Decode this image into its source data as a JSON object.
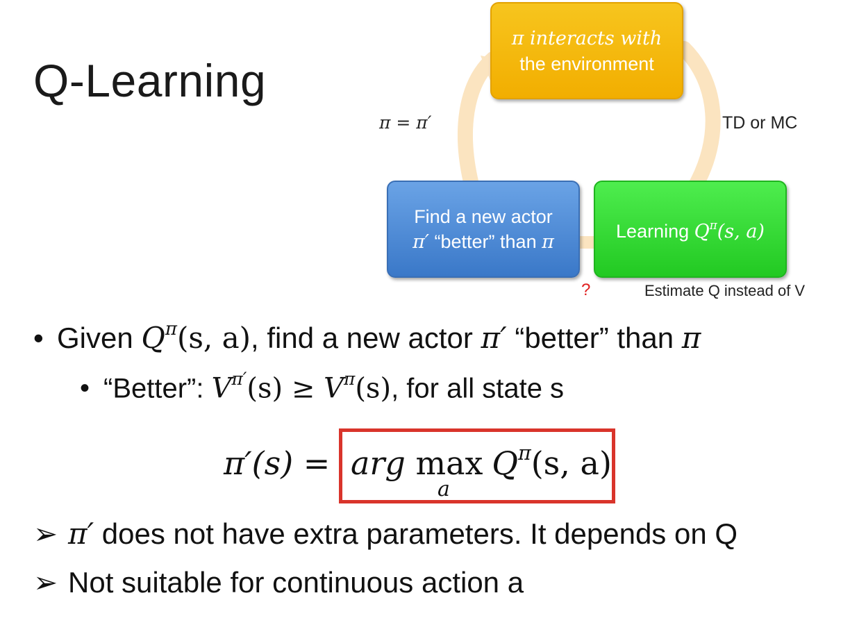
{
  "slide": {
    "title": "Q-Learning"
  },
  "diagram": {
    "box_interacts_line1": "π interacts with",
    "box_interacts_line2": "the environment",
    "box_actor_line1": "Find a new actor",
    "box_actor_line2_pi": "π′",
    "box_actor_line2_text": " “better” than ",
    "box_actor_line2_pi2": "π",
    "box_learning_text": "Learning ",
    "box_learning_math": "Q",
    "box_learning_sup": "π",
    "box_learning_args": "(s, a)",
    "label_left": "π = π′",
    "label_right": "TD or MC",
    "label_question": "?",
    "label_estimate": "Estimate Q instead of V",
    "colors": {
      "yellow": "#f2ae00",
      "blue": "#3a78c8",
      "green": "#22c922",
      "cycle_arrow": "#fbe4c0",
      "highlight_box": "#d9342b"
    }
  },
  "bullets": {
    "b1_prefix": "Given ",
    "b1_q": "Q",
    "b1_sup": "π",
    "b1_args": "(s, a)",
    "b1_mid": ", find a new actor ",
    "b1_pi": "π′",
    "b1_end": " “better” than ",
    "b1_pi2": "π",
    "b2_prefix": "“Better”: ",
    "b2_v1": "V",
    "b2_sup1": "π′",
    "b2_arg1": "(s) ≥ ",
    "b2_v2": "V",
    "b2_sup2": "π",
    "b2_arg2": "(s)",
    "b2_end": ", for all state s",
    "b3_pi": "π′",
    "b3_text": " does not have extra parameters. It depends on Q",
    "b4_text": "Not suitable for continuous action a"
  },
  "equation": {
    "lhs": "π′(s) =",
    "arg": "arg ",
    "max": "max",
    "q": "Q",
    "sup": "π",
    "args": "(s, a)",
    "sub": "a"
  }
}
